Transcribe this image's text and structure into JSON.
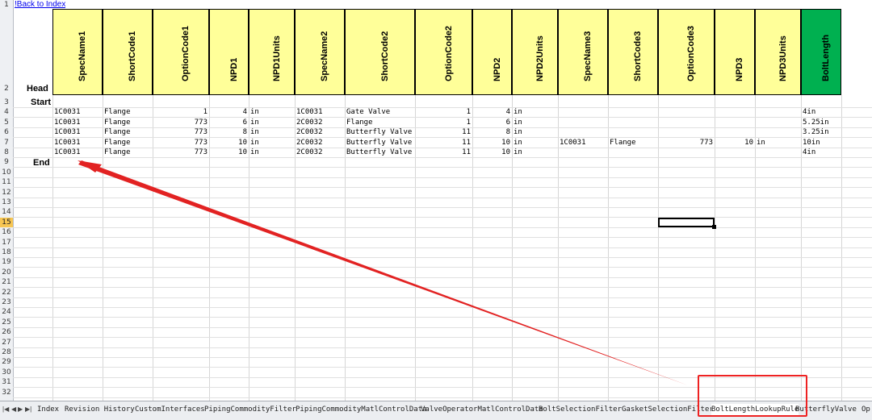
{
  "back_link": "!Back to Index",
  "row_labels": {
    "head": "Head",
    "start": "Start",
    "end": "End"
  },
  "row_numbers": [
    "1",
    "2",
    "3",
    "4",
    "5",
    "6",
    "7",
    "8",
    "9",
    "10",
    "11",
    "12",
    "13",
    "14",
    "15",
    "16",
    "17",
    "18",
    "19",
    "20",
    "21",
    "22",
    "23",
    "24",
    "25",
    "26",
    "27",
    "28",
    "29",
    "30",
    "31",
    "32"
  ],
  "active_row": "15",
  "columns": [
    "SpecName1",
    "ShortCode1",
    "OptionCode1",
    "NPD1",
    "NPD1Units",
    "SpecName2",
    "ShortCode2",
    "OptionCode2",
    "NPD2",
    "NPD2Units",
    "SpecName3",
    "ShortCode3",
    "OptionCode3",
    "NPD3",
    "NPD3Units",
    "BoltLength"
  ],
  "rows": [
    [
      "1C0031",
      "Flange",
      "1",
      "4",
      "in",
      "1C0031",
      "Gate Valve",
      "1",
      "4",
      "in",
      "",
      "",
      "",
      "",
      "",
      "4in"
    ],
    [
      "1C0031",
      "Flange",
      "773",
      "6",
      "in",
      "2C0032",
      "Flange",
      "1",
      "6",
      "in",
      "",
      "",
      "",
      "",
      "",
      "5.25in"
    ],
    [
      "1C0031",
      "Flange",
      "773",
      "8",
      "in",
      "2C0032",
      "Butterfly Valve",
      "11",
      "8",
      "in",
      "",
      "",
      "",
      "",
      "",
      "3.25in"
    ],
    [
      "1C0031",
      "Flange",
      "773",
      "10",
      "in",
      "2C0032",
      "Butterfly Valve",
      "11",
      "10",
      "in",
      "1C0031",
      "Flange",
      "773",
      "10",
      "in",
      "10in"
    ],
    [
      "1C0031",
      "Flange",
      "773",
      "10",
      "in",
      "2C0032",
      "Butterfly Valve",
      "11",
      "10",
      "in",
      "",
      "",
      "",
      "",
      "",
      "4in"
    ]
  ],
  "tabs": [
    "Index",
    "Revision History",
    "CustomInterfaces",
    "PipingCommodityFilter",
    "PipingCommodityMatlControlData",
    "ValveOperatorMatlControlData",
    "BoltSelectionFilter",
    "GasketSelectionFilter",
    "BoltLengthLookupRule",
    "ButterflyValve",
    "Op"
  ],
  "active_tab": "BoltLengthLookupRule",
  "colors": {
    "header_fill": "#ffff99",
    "boltlength_fill": "#00b050",
    "annotation_red": "#e22222"
  }
}
